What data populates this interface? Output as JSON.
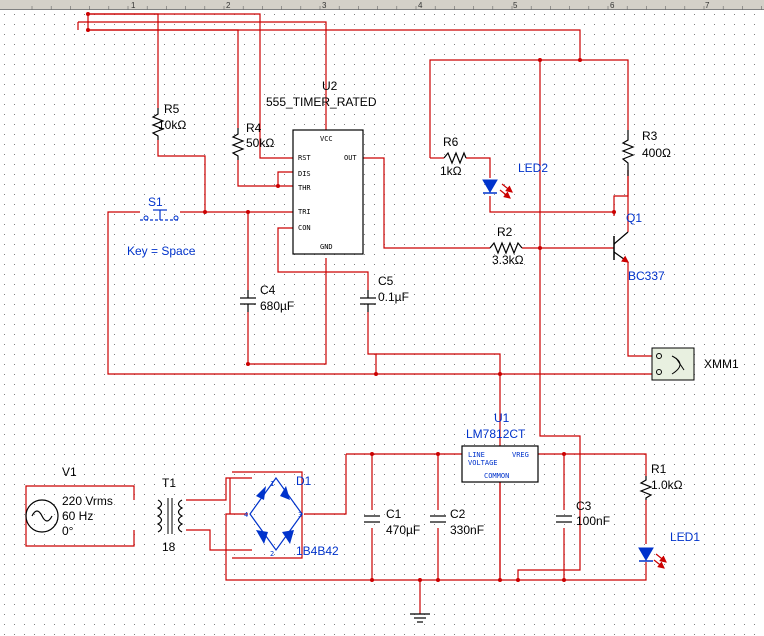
{
  "ruler": {
    "ticks": [
      "1",
      "2",
      "3",
      "4",
      "5",
      "6",
      "7"
    ]
  },
  "components": {
    "u2_ref": "U2",
    "u2_part": "555_TIMER_RATED",
    "u2_pins": {
      "vcc": "VCC",
      "rst": "RST",
      "dis": "DIS",
      "thr": "THR",
      "tri": "TRI",
      "con": "CON",
      "out": "OUT",
      "gnd": "GND"
    },
    "r5_ref": "R5",
    "r5_val": "10kΩ",
    "r4_ref": "R4",
    "r4_val": "50kΩ",
    "r6_ref": "R6",
    "r6_val": "1kΩ",
    "r3_ref": "R3",
    "r3_val": "400Ω",
    "r2_ref": "R2",
    "r2_val": "3.3kΩ",
    "r1_ref": "R1",
    "r1_val": "1.0kΩ",
    "led2": "LED2",
    "led1": "LED1",
    "s1_ref": "S1",
    "s1_key": "Key = Space",
    "q1_ref": "Q1",
    "q1_part": "BC337",
    "c4_ref": "C4",
    "c4_val": "680µF",
    "c5_ref": "C5",
    "c5_val": "0.1µF",
    "c1_ref": "C1",
    "c1_val": "470µF",
    "c2_ref": "C2",
    "c2_val": "330nF",
    "c3_ref": "C3",
    "c3_val": "100nF",
    "xmm": "XMM1",
    "u1_ref": "U1",
    "u1_part": "LM7812CT",
    "u1_pins": {
      "line1": "LINE",
      "line2": "VOLTAGE",
      "vreg": "VREG",
      "common": "COMMON"
    },
    "v1_ref": "V1",
    "v1_v": "220 Vrms",
    "v1_f": "60 Hz",
    "v1_p": "0°",
    "t1_ref": "T1",
    "t1_val": "18",
    "d1_ref": "D1",
    "d1_part": "1B4B42",
    "d1_pins": {
      "p1": "1",
      "p2": "2",
      "p3": "3",
      "p4": "4"
    }
  },
  "colors": {
    "wire": "#cc0000",
    "label": "#000000",
    "part_label": "#0033cc",
    "grid": "#808080"
  }
}
